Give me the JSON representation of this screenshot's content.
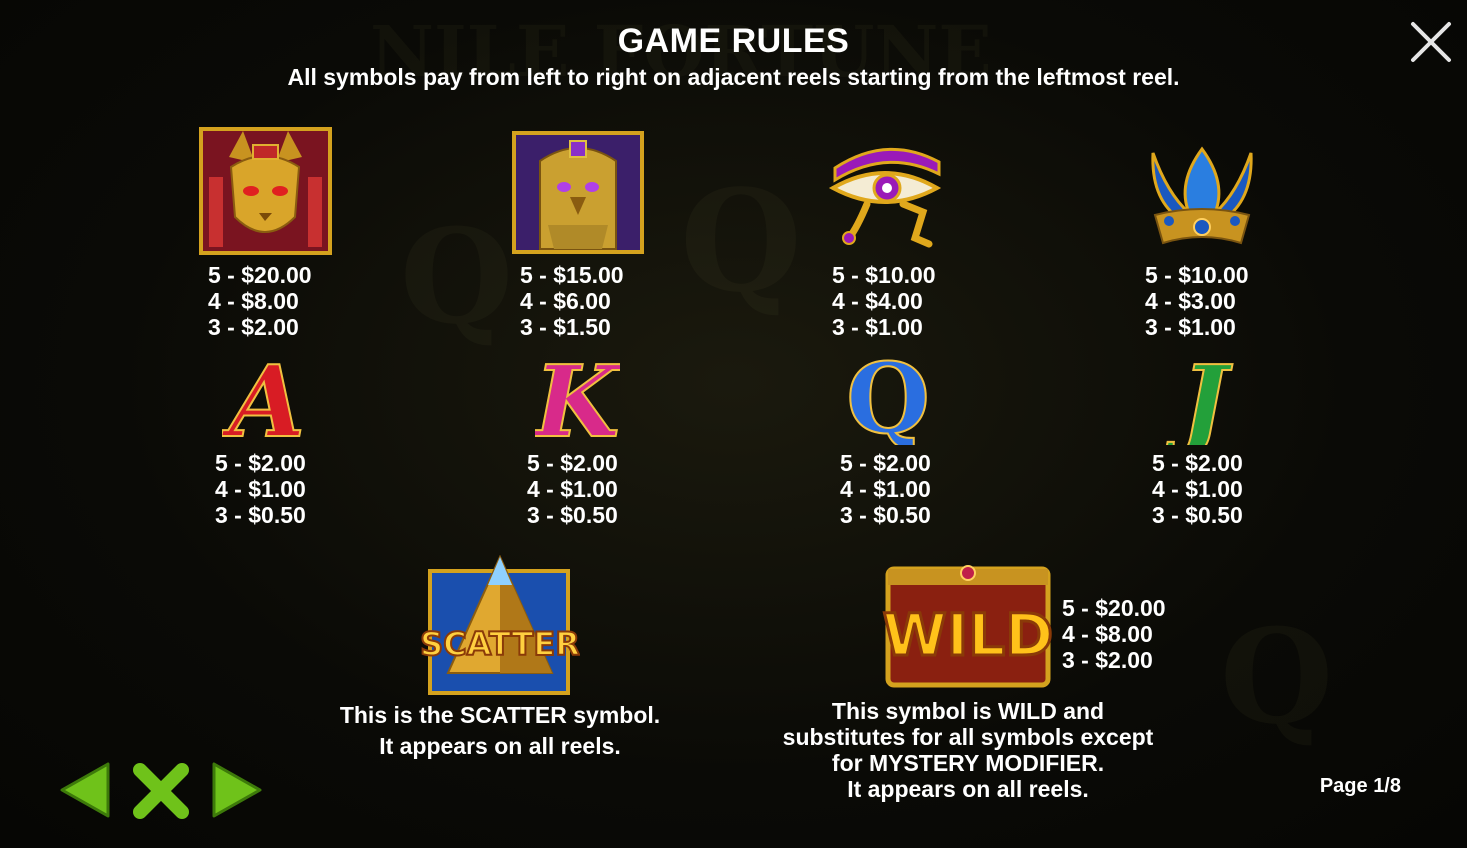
{
  "header": {
    "title": "GAME RULES",
    "subtitle": "All symbols pay from left to right on adjacent reels starting from the leftmost reel."
  },
  "symbols": [
    {
      "name": "bastet",
      "pays": [
        "5 - $20.00",
        "4 - $8.00",
        "3 - $2.00"
      ]
    },
    {
      "name": "horus",
      "pays": [
        "5 - $15.00",
        "4 - $6.00",
        "3 - $1.50"
      ]
    },
    {
      "name": "eye-of-ra",
      "pays": [
        "5 - $10.00",
        "4 - $4.00",
        "3 - $1.00"
      ]
    },
    {
      "name": "lotus",
      "pays": [
        "5 - $10.00",
        "4 - $3.00",
        "3 - $1.00"
      ]
    },
    {
      "name": "A",
      "glyph": "A",
      "color": "#e0202a",
      "pays": [
        "5 - $2.00",
        "4 - $1.00",
        "3 - $0.50"
      ]
    },
    {
      "name": "K",
      "glyph": "K",
      "color": "#e02a8c",
      "pays": [
        "5 - $2.00",
        "4 - $1.00",
        "3 - $0.50"
      ]
    },
    {
      "name": "Q",
      "glyph": "Q",
      "color": "#2a6ee0",
      "pays": [
        "5 - $2.00",
        "4 - $1.00",
        "3 - $0.50"
      ]
    },
    {
      "name": "J",
      "glyph": "J",
      "color": "#2aa83a",
      "pays": [
        "5 - $2.00",
        "4 - $1.00",
        "3 - $0.50"
      ]
    }
  ],
  "scatter": {
    "logo_text": "SCATTER",
    "desc_line1": "This is the SCATTER symbol.",
    "desc_line2": "It appears on all reels."
  },
  "wild": {
    "logo_text": "WILD",
    "pays": [
      "5 - $20.00",
      "4 - $8.00",
      "3 - $2.00"
    ],
    "desc_line1": "This symbol is WILD and",
    "desc_line2": "substitutes for all symbols except",
    "desc_line3": "for MYSTERY MODIFIER.",
    "desc_line4": "It appears on all reels."
  },
  "footer": {
    "page_label": "Page 1/8"
  },
  "colors": {
    "nav_green": "#6fc21a",
    "gold": "#e0a81c"
  }
}
